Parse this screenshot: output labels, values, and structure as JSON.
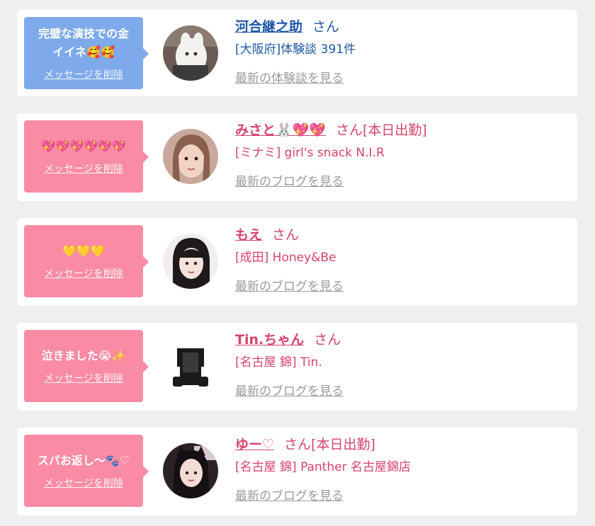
{
  "colors": {
    "bubble_blue": "#7ea9ea",
    "bubble_pink": "#f98ba4",
    "text_blue": "#1e57a8",
    "text_pink": "#d6436b",
    "link_gray": "#9a9a9a"
  },
  "items": [
    {
      "message_line1": "完璧な演技での金",
      "message_line2": "イイネ🥰🥰",
      "delete_label": "メッセージを削除",
      "name": "河合継之助",
      "honorific": "さん",
      "extra": "",
      "shop": "[大阪府]体験談 391件",
      "link_label": "最新の体験談を見る",
      "avatar_icon": "cat-plush-avatar"
    },
    {
      "message_line1": "💖💖💖💖💖💖",
      "message_line2": "",
      "delete_label": "メッセージを削除",
      "name": "みさと🐰💖💖",
      "honorific": "さん",
      "extra": "[本日出勤]",
      "shop": "[ミナミ] girl's snack N.I.R",
      "link_label": "最新のブログを見る",
      "avatar_icon": "woman-photo-avatar"
    },
    {
      "message_line1": "💛💛💛",
      "message_line2": "",
      "delete_label": "メッセージを削除",
      "name": "もえ",
      "honorific": "さん",
      "extra": "",
      "shop": "[成田] Honey&Be",
      "link_label": "最新のブログを見る",
      "avatar_icon": "woman-photo-avatar"
    },
    {
      "message_line1": "泣きました😭✨",
      "message_line2": "",
      "delete_label": "メッセージを削除",
      "name": "Tin.ちゃん",
      "honorific": "さん",
      "extra": "",
      "shop": "[名古屋 錦] Tin.",
      "link_label": "最新のブログを見る",
      "avatar_icon": "silhouette-avatar"
    },
    {
      "message_line1": "スパお返し〜🐾♡",
      "message_line2": "",
      "delete_label": "メッセージを削除",
      "name": "ゆー♡",
      "honorific": "さん",
      "extra": "[本日出勤]",
      "shop": "[名古屋 錦] Panther 名古屋錦店",
      "link_label": "最新のブログを見る",
      "avatar_icon": "woman-photo-avatar"
    }
  ]
}
